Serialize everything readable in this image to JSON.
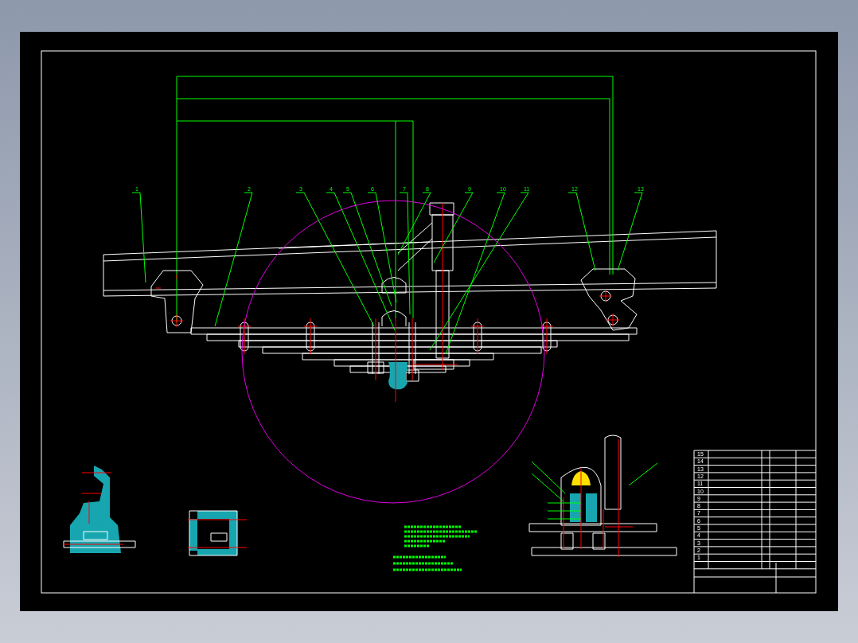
{
  "drawing": {
    "balloons": [
      "1",
      "2",
      "3",
      "4",
      "5",
      "6",
      "7",
      "8",
      "9",
      "10",
      "11",
      "12",
      "13"
    ],
    "parts_list": {
      "rows": [
        {
          "no": "15"
        },
        {
          "no": "14"
        },
        {
          "no": "13"
        },
        {
          "no": "12"
        },
        {
          "no": "11"
        },
        {
          "no": "10"
        },
        {
          "no": "9"
        },
        {
          "no": "8"
        },
        {
          "no": "7"
        },
        {
          "no": "6"
        },
        {
          "no": "5"
        },
        {
          "no": "4"
        },
        {
          "no": "3"
        },
        {
          "no": "2"
        },
        {
          "no": "1"
        }
      ]
    }
  }
}
